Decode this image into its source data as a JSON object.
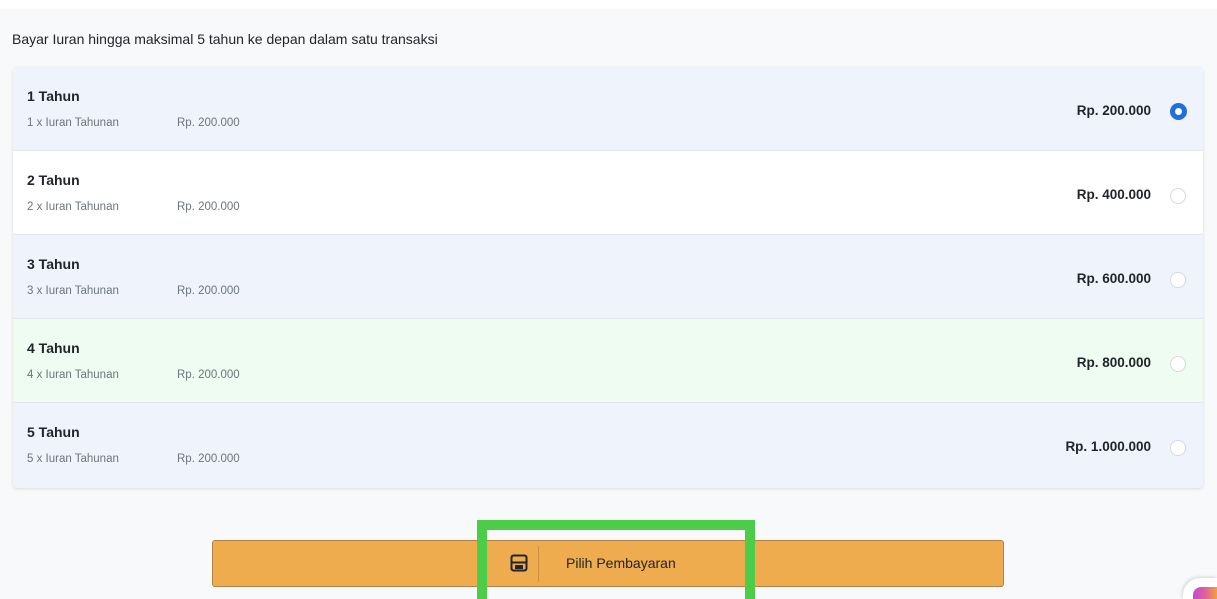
{
  "intro_text": "Bayar Iuran hingga maksimal 5 tahun ke depan dalam satu transaksi",
  "options": [
    {
      "title": "1 Tahun",
      "subtitle": "1 x Iuran Tahunan",
      "unit_price": "Rp. 200.000",
      "total": "Rp. 200.000",
      "selected": true
    },
    {
      "title": "2 Tahun",
      "subtitle": "2 x Iuran Tahunan",
      "unit_price": "Rp. 200.000",
      "total": "Rp. 400.000",
      "selected": false
    },
    {
      "title": "3 Tahun",
      "subtitle": "3 x Iuran Tahunan",
      "unit_price": "Rp. 200.000",
      "total": "Rp. 600.000",
      "selected": false
    },
    {
      "title": "4 Tahun",
      "subtitle": "4 x Iuran Tahunan",
      "unit_price": "Rp. 200.000",
      "total": "Rp. 800.000",
      "selected": false
    },
    {
      "title": "5 Tahun",
      "subtitle": "5 x Iuran Tahunan",
      "unit_price": "Rp. 200.000",
      "total": "Rp. 1.000.000",
      "selected": false
    }
  ],
  "submit_button": {
    "label": "Pilih Pembayaran",
    "icon": "save-icon"
  },
  "colors": {
    "accent": "#1f6fe0",
    "button": "#eeac4f",
    "highlight": "#4ccd4a"
  }
}
